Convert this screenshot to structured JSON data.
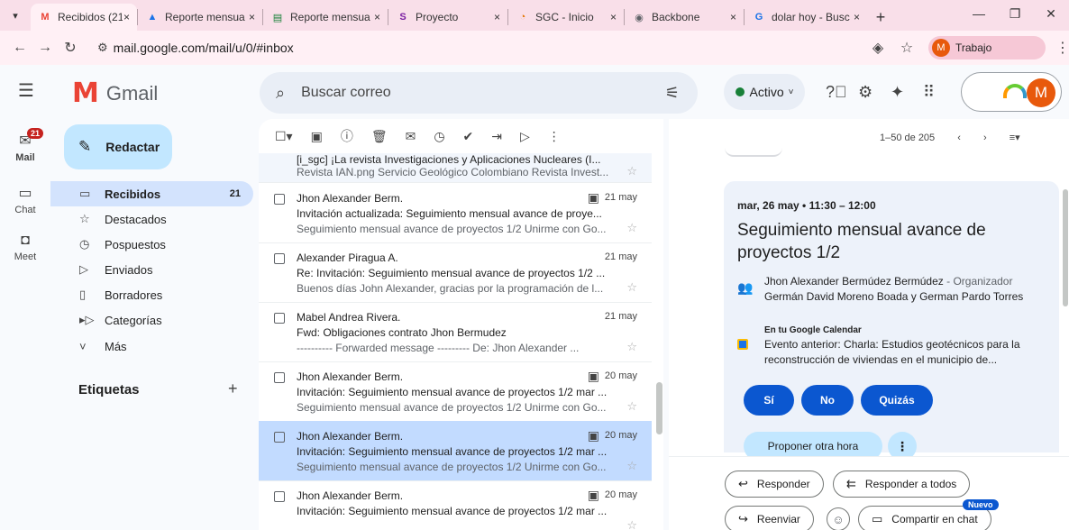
{
  "browser": {
    "tabs": [
      {
        "title": "Recibidos (21) -",
        "favicon": "M",
        "favicon_color": "#ea4335",
        "active": true
      },
      {
        "title": "Reporte mensua",
        "favicon": "▲",
        "favicon_color": "#1a73e8",
        "active": false
      },
      {
        "title": "Reporte mensua",
        "favicon": "▤",
        "favicon_color": "#188038",
        "active": false
      },
      {
        "title": "Proyecto",
        "favicon": "S",
        "favicon_color": "#7b1fa2",
        "active": false
      },
      {
        "title": "SGC - Inicio",
        "favicon": "◔",
        "favicon_color": "#e37400",
        "active": false
      },
      {
        "title": "Backbone",
        "favicon": "◉",
        "favicon_color": "#5f6368",
        "active": false
      },
      {
        "title": "dolar hoy - Busc",
        "favicon": "G",
        "favicon_color": "#1a73e8",
        "active": false
      }
    ],
    "tab_close": "×",
    "new_tab": "+",
    "url": "mail.google.com/mail/u/0/#inbox",
    "profile_initial": "M",
    "profile_name": "Trabajo"
  },
  "gmail": {
    "product": "Gmail",
    "search_placeholder": "Buscar correo",
    "status": "Activo",
    "avatar_initial": "M"
  },
  "rail": {
    "mail_label": "Mail",
    "mail_badge": "21",
    "chat_label": "Chat",
    "meet_label": "Meet"
  },
  "sidebar": {
    "compose": "Redactar",
    "items": [
      {
        "label": "Recibidos",
        "count": "21",
        "icon": "inbox-icon"
      },
      {
        "label": "Destacados",
        "count": "",
        "icon": "star-icon"
      },
      {
        "label": "Pospuestos",
        "count": "",
        "icon": "clock-icon"
      },
      {
        "label": "Enviados",
        "count": "",
        "icon": "send-icon"
      },
      {
        "label": "Borradores",
        "count": "",
        "icon": "draft-icon"
      },
      {
        "label": "Categorías",
        "count": "",
        "icon": "label-icon"
      },
      {
        "label": "Más",
        "count": "",
        "icon": "chevron-down-icon"
      }
    ],
    "labels_heading": "Etiquetas"
  },
  "list": {
    "pagination": "1–50 de 205",
    "rows": [
      {
        "sender": "",
        "date": "",
        "has_cal": false,
        "subject": "[i_sgc] ¡La revista Investigaciones y Aplicaciones Nucleares (I...",
        "snippet": "Revista IAN.png Servicio Geológico Colombiano Revista Invest...",
        "selected": false
      },
      {
        "sender": "Jhon Alexander Berm.",
        "date": "21 may",
        "has_cal": true,
        "subject": "Invitación actualizada: Seguimiento mensual avance de proye...",
        "snippet": "Seguimiento mensual avance de proyectos 1/2 Unirme con Go...",
        "selected": false
      },
      {
        "sender": "Alexander Piragua A.",
        "date": "21 may",
        "has_cal": false,
        "subject": "Re: Invitación: Seguimiento mensual avance de proyectos 1/2 ...",
        "snippet": "Buenos días John Alexander, gracias por la programación de l...",
        "selected": false
      },
      {
        "sender": "Mabel Andrea Rivera.",
        "date": "21 may",
        "has_cal": false,
        "subject": "Fwd: Obligaciones contrato Jhon Bermudez",
        "snippet": "---------- Forwarded message --------- De: Jhon Alexander ...",
        "selected": false
      },
      {
        "sender": "Jhon Alexander Berm.",
        "date": "20 may",
        "has_cal": true,
        "subject": "Invitación: Seguimiento mensual avance de proyectos 1/2 mar ...",
        "snippet": "Seguimiento mensual avance de proyectos 1/2 Unirme con Go...",
        "selected": false
      },
      {
        "sender": "Jhon Alexander Berm.",
        "date": "20 may",
        "has_cal": true,
        "subject": "Invitación: Seguimiento mensual avance de proyectos 1/2 mar ...",
        "snippet": "Seguimiento mensual avance de proyectos 1/2 Unirme con Go...",
        "selected": true
      },
      {
        "sender": "Jhon Alexander Berm.",
        "date": "20 may",
        "has_cal": true,
        "subject": "Invitación: Seguimiento mensual avance de proyectos 1/2 mar ...",
        "snippet": "",
        "selected": false
      }
    ]
  },
  "event": {
    "date_time": "mar, 26 may • 11:30 – 12:00",
    "title": "Seguimiento mensual avance de proyectos 1/2",
    "organizer": "Jhon Alexander Bermúdez Bermúdez",
    "organizer_role": " - Organizador",
    "guests": "Germán David Moreno Boada y German Pardo Torres",
    "calendar_label": "En tu Google Calendar",
    "previous_event": "Evento anterior: Charla: Estudios geotécnicos para la reconstrucción de viviendas en el municipio de...",
    "rsvp_yes": "Sí",
    "rsvp_no": "No",
    "rsvp_maybe": "Quizás",
    "propose": "Proponer otra hora",
    "more": "⋮"
  },
  "reply_actions": {
    "reply": "Responder",
    "reply_all": "Responder a todos",
    "forward": "Reenviar",
    "share_chat": "Compartir en chat",
    "new_badge": "Nuevo"
  }
}
